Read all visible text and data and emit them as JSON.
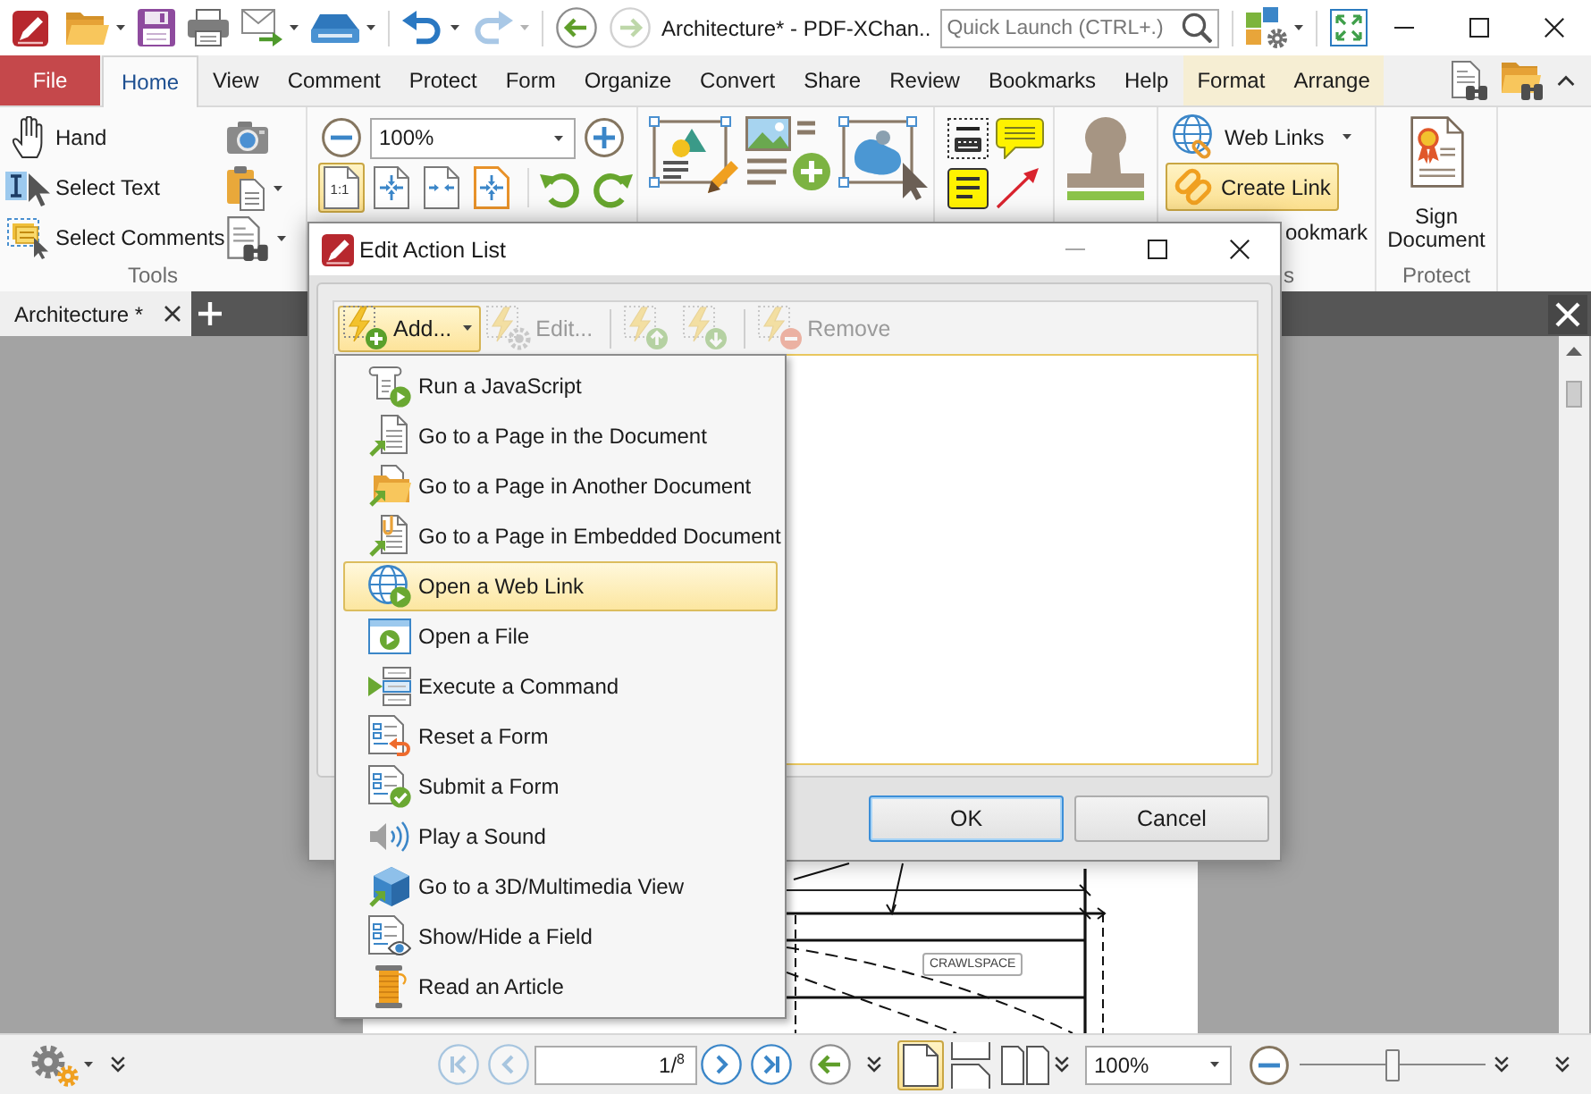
{
  "title_bar": {
    "quick_access": [
      {
        "kind": "open",
        "dropdown": true,
        "disabled": false
      },
      {
        "kind": "save",
        "dropdown": false,
        "disabled": false
      },
      {
        "kind": "print",
        "dropdown": false,
        "disabled": false
      },
      {
        "kind": "email",
        "dropdown": true,
        "disabled": false
      },
      {
        "kind": "scan",
        "dropdown": true,
        "disabled": false
      },
      {
        "kind": "undo",
        "dropdown": true,
        "disabled": false
      },
      {
        "kind": "redo",
        "dropdown": true,
        "disabled": true
      }
    ],
    "navigation": [
      {
        "kind": "back",
        "disabled": false
      },
      {
        "kind": "forward",
        "disabled": true
      }
    ],
    "title": "Architecture* - PDF-XChan..",
    "quick_launch": {
      "placeholder": "Quick Launch (CTRL+.)"
    }
  },
  "ribbon_tabs": [
    {
      "label": "File",
      "kind": "file",
      "selected": false
    },
    {
      "label": "Home",
      "kind": "tab",
      "selected": true
    },
    {
      "label": "View",
      "kind": "tab",
      "selected": false
    },
    {
      "label": "Comment",
      "kind": "tab",
      "selected": false
    },
    {
      "label": "Protect",
      "kind": "tab",
      "selected": false
    },
    {
      "label": "Form",
      "kind": "tab",
      "selected": false
    },
    {
      "label": "Organize",
      "kind": "tab",
      "selected": false
    },
    {
      "label": "Convert",
      "kind": "tab",
      "selected": false
    },
    {
      "label": "Share",
      "kind": "tab",
      "selected": false
    },
    {
      "label": "Review",
      "kind": "tab",
      "selected": false
    },
    {
      "label": "Bookmarks",
      "kind": "tab",
      "selected": false
    },
    {
      "label": "Help",
      "kind": "tab",
      "selected": false
    },
    {
      "label": "Format",
      "kind": "contextual",
      "selected": false
    },
    {
      "label": "Arrange",
      "kind": "contextual",
      "selected": false
    }
  ],
  "ribbon": {
    "tools": {
      "label": "Tools",
      "items": [
        {
          "label": "Hand",
          "kind": "hand"
        },
        {
          "label": "Select Text",
          "kind": "select_text"
        },
        {
          "label": "Select Comments",
          "kind": "select_comments"
        }
      ]
    },
    "view": {
      "zoom": "100%",
      "page_buttons": [
        {
          "kind": "actual_size",
          "label": "1:1",
          "selected": true
        },
        {
          "kind": "fit_page",
          "selected": false
        },
        {
          "kind": "fit_width",
          "selected": false
        },
        {
          "kind": "fit_visible",
          "selected": false
        }
      ]
    },
    "links": {
      "label": "s",
      "items": [
        {
          "label": "Web Links",
          "kind": "web_links",
          "dropdown": true,
          "selected": false
        },
        {
          "label": "Create Link",
          "kind": "create_link",
          "dropdown": false,
          "selected": true
        },
        {
          "label": "ookmark",
          "kind": "bookmark",
          "dropdown": false,
          "selected": false
        }
      ]
    },
    "protect": {
      "label": "Protect",
      "items": [
        {
          "label": "Sign Document",
          "kind": "sign"
        }
      ]
    }
  },
  "document_tabs": [
    {
      "label": "Architecture *",
      "selected": true
    }
  ],
  "document": {
    "labels": [
      "CRAWLSPACE"
    ]
  },
  "status_bar": {
    "page_navigation": [
      {
        "kind": "first",
        "disabled": true
      },
      {
        "kind": "previous",
        "disabled": true
      },
      {
        "kind": "next",
        "disabled": false
      },
      {
        "kind": "last",
        "disabled": false
      }
    ],
    "page": "1/$^{8}$",
    "views": [
      {
        "kind": "single",
        "selected": true
      },
      {
        "kind": "continuous",
        "selected": false
      },
      {
        "kind": "facing",
        "selected": false
      }
    ],
    "zoom": "100%",
    "zoom_slider": {
      "level": 0.5
    }
  },
  "dialog": {
    "title": "Edit Action List",
    "window_controls": [
      {
        "kind": "minimize",
        "disabled": true
      },
      {
        "kind": "maximize",
        "disabled": false
      },
      {
        "kind": "close",
        "disabled": false
      }
    ],
    "toolbar": [
      {
        "label": "Add...",
        "kind": "add",
        "dropdown": true,
        "expanded": true,
        "disabled": false
      },
      {
        "label": "Edit...",
        "kind": "edit",
        "dropdown": false,
        "expanded": false,
        "disabled": true
      },
      {
        "kind": "move_up",
        "dropdown": false,
        "expanded": false,
        "disabled": true
      },
      {
        "kind": "move_down",
        "dropdown": false,
        "expanded": false,
        "disabled": true
      },
      {
        "label": "Remove",
        "kind": "remove",
        "dropdown": false,
        "expanded": false,
        "disabled": true
      }
    ],
    "buttons": [
      {
        "label": "OK",
        "kind": "default"
      },
      {
        "label": "Cancel",
        "kind": "normal"
      }
    ]
  },
  "action_menu": {
    "items": [
      {
        "label": "Run a JavaScript",
        "kind": "javascript",
        "selected": false
      },
      {
        "label": "Go to a Page in the Document",
        "kind": "goto_page",
        "selected": false
      },
      {
        "label": "Go to a Page in Another Document",
        "kind": "goto_other_doc",
        "selected": false
      },
      {
        "label": "Go to a Page in Embedded Document",
        "kind": "goto_embedded",
        "selected": false
      },
      {
        "label": "Open a Web Link",
        "kind": "web_link",
        "selected": true
      },
      {
        "label": "Open a File",
        "kind": "open_file",
        "selected": false
      },
      {
        "label": "Execute a Command",
        "kind": "command",
        "selected": false
      },
      {
        "label": "Reset a Form",
        "kind": "reset_form",
        "selected": false
      },
      {
        "label": "Submit a Form",
        "kind": "submit_form",
        "selected": false
      },
      {
        "label": "Play a Sound",
        "kind": "sound",
        "selected": false
      },
      {
        "label": "Go to a 3D/Multimedia View",
        "kind": "view_3d",
        "selected": false
      },
      {
        "label": "Show/Hide a Field",
        "kind": "show_hide",
        "selected": false
      },
      {
        "label": "Read an Article",
        "kind": "article",
        "selected": false
      }
    ]
  }
}
